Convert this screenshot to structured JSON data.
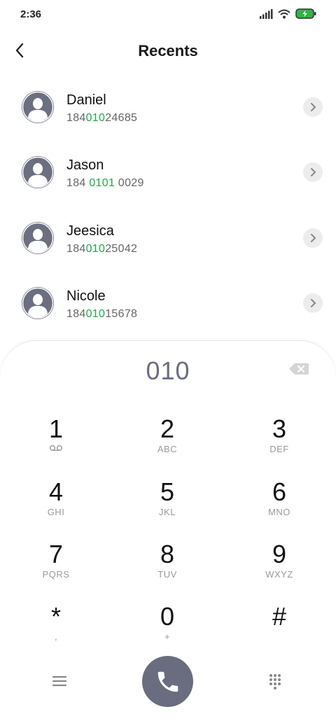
{
  "status": {
    "time": "2:36",
    "icons": [
      "signal-icon",
      "wifi-icon",
      "battery-charging-icon"
    ],
    "battery_color": "#2fb344"
  },
  "header": {
    "title": "Recents",
    "back_icon": "chevron-left-icon"
  },
  "contacts": [
    {
      "name": "Daniel",
      "number_parts": [
        "184",
        "010",
        "24685"
      ]
    },
    {
      "name": "Jason",
      "number_parts": [
        "184 ",
        "0101",
        " 0029"
      ]
    },
    {
      "name": "Jeesica",
      "number_parts": [
        "184",
        "010",
        "25042"
      ]
    },
    {
      "name": "Nicole",
      "number_parts": [
        "184",
        "010",
        "15678"
      ]
    }
  ],
  "dialpad": {
    "input": "010",
    "keys": [
      {
        "digit": "1",
        "letters": "voicemail-icon"
      },
      {
        "digit": "2",
        "letters": "ABC"
      },
      {
        "digit": "3",
        "letters": "DEF"
      },
      {
        "digit": "4",
        "letters": "GHI"
      },
      {
        "digit": "5",
        "letters": "JKL"
      },
      {
        "digit": "6",
        "letters": "MNO"
      },
      {
        "digit": "7",
        "letters": "PQRS"
      },
      {
        "digit": "8",
        "letters": "TUV"
      },
      {
        "digit": "9",
        "letters": "WXYZ"
      },
      {
        "digit": "*",
        "letters": ","
      },
      {
        "digit": "0",
        "letters": "+"
      },
      {
        "digit": "#",
        "letters": ""
      }
    ]
  },
  "colors": {
    "accent_match": "#1fa84a",
    "avatar": "#6c6f80",
    "call_button": "#6a6d7f"
  }
}
